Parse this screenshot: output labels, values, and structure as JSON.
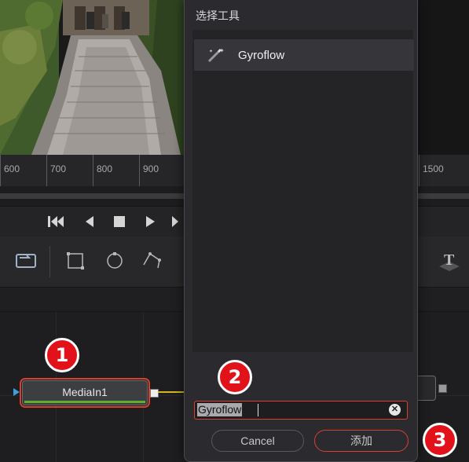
{
  "ruler": {
    "ticks": [
      "600",
      "700",
      "800",
      "900",
      "1500"
    ]
  },
  "transport": {
    "buttons": [
      "skip-to-start",
      "step-back",
      "stop",
      "play",
      "skip-to-end"
    ]
  },
  "toolbar": {
    "tools": [
      "loop-icon",
      "rectangle-mask-icon",
      "ellipse-mask-icon",
      "polygon-mask-icon",
      "text-3d-icon"
    ]
  },
  "node": {
    "label": "MediaIn1",
    "accent": "#5fae2c"
  },
  "dialog": {
    "title": "选择工具",
    "items": [
      {
        "label": "Gyroflow",
        "icon": "magic-wand-icon"
      }
    ],
    "search_value": "Gyroflow",
    "cancel_label": "Cancel",
    "add_label": "添加"
  },
  "badges": [
    "1",
    "2",
    "3"
  ],
  "colors": {
    "highlight": "#d7402e",
    "badge": "#e2121b",
    "link": "#d8b51d"
  }
}
